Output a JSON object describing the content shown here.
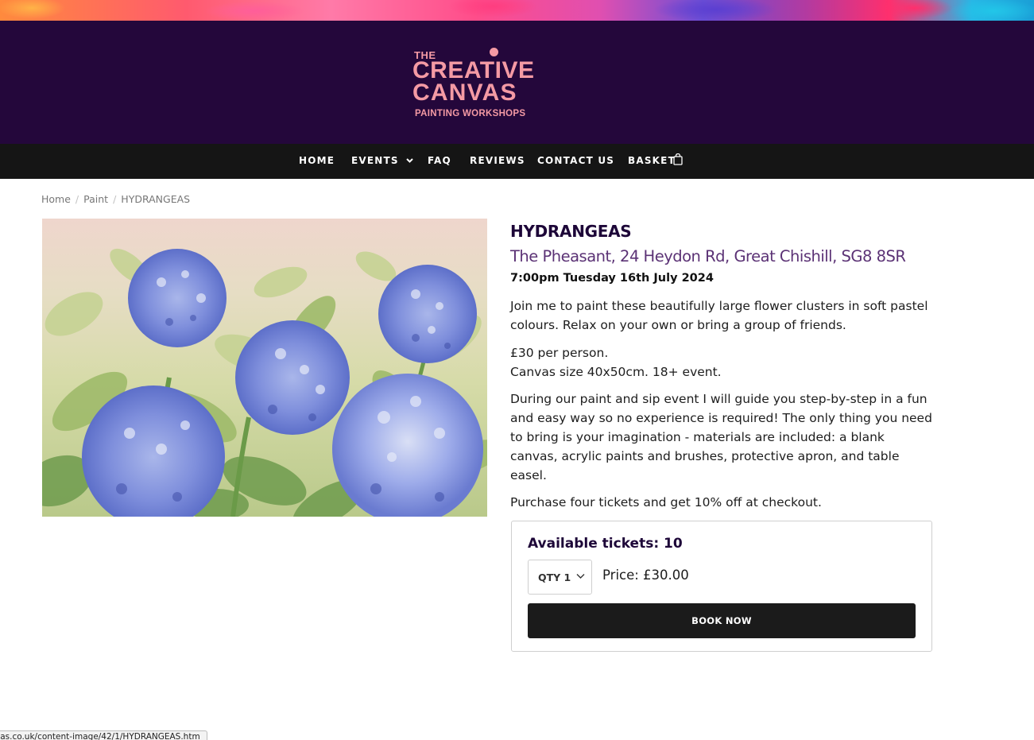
{
  "logo": {
    "the": "THE",
    "line1": "CREATIVE",
    "line2": "CANVAS",
    "tagline": "PAINTING WORKSHOPS"
  },
  "nav": {
    "home": "HOME",
    "events": "EVENTS",
    "faq": "FAQ",
    "reviews": "REVIEWS",
    "contact": "CONTACT US",
    "basket": "BASKET"
  },
  "breadcrumb": {
    "home": "Home",
    "category": "Paint",
    "current": "HYDRANGEAS",
    "separator": "/"
  },
  "product": {
    "title": "HYDRANGEAS",
    "venue": "The Pheasant, 24 Heydon Rd, Great Chishill, SG8 8SR",
    "datetime": "7:00pm Tuesday 16th July 2024",
    "intro": "Join me to paint these beautifully large flower clusters in soft pastel colours. Relax on your own or bring a group of friends.",
    "price_line": "£30 per person.",
    "canvas_line": "Canvas size 40x50cm. 18+ event.",
    "details": "During our paint and sip event I will guide you step-by-step in a fun and easy way so no experience is required! The only thing you need to bring is your imagination - materials are included: a blank canvas, acrylic paints and brushes, protective apron, and table easel.",
    "offer": "Purchase four tickets and get 10% off at checkout."
  },
  "booking": {
    "available": "Available tickets: 10",
    "qty": "QTY 1",
    "price": "Price: £30.00",
    "button": "BOOK NOW"
  },
  "status_bar": {
    "url": "vas.co.uk/content-image/42/1/HYDRANGEAS.htm"
  },
  "colors": {
    "header_bg": "#24073b",
    "nav_bg": "#151515",
    "logo": "#f49aa4",
    "title": "#1d0638",
    "venue": "#5b3275",
    "button_bg": "#1b1b1b"
  },
  "icons": {
    "events_dropdown": "chevron-down-icon",
    "basket": "shopping-bag-icon",
    "qty_dropdown": "chevron-down-icon"
  }
}
